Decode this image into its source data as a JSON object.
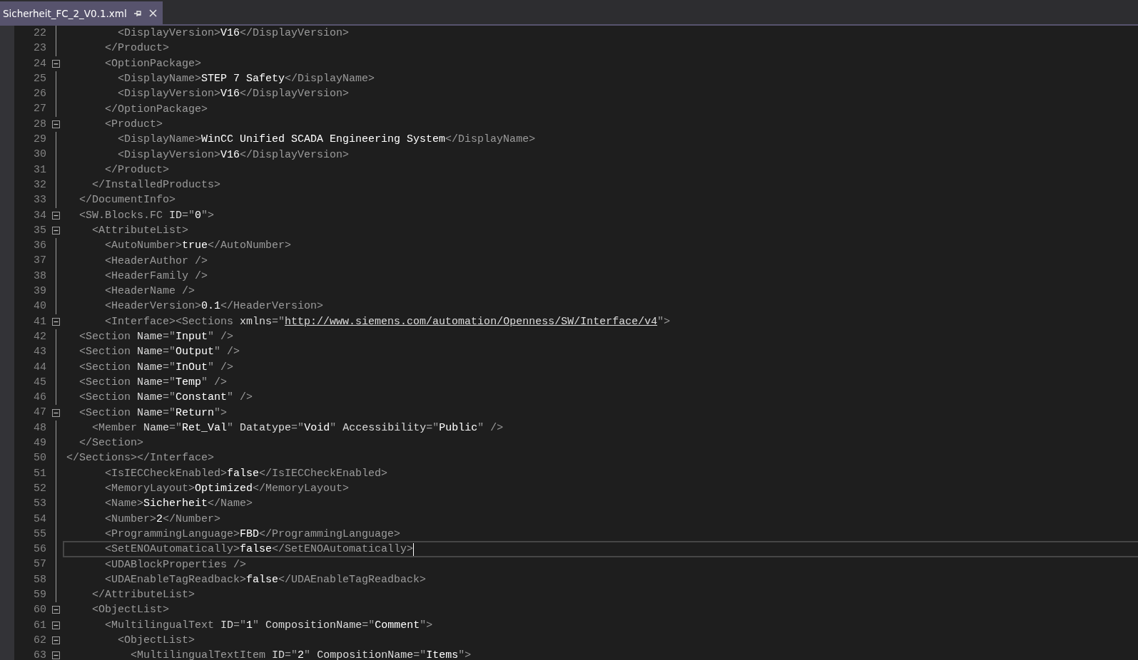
{
  "tab": {
    "title": "Sicherheit_FC_2_V0.1.xml"
  },
  "lines": [
    {
      "number": "22",
      "code": "        <DisplayVersion>V16</DisplayVersion>",
      "fold": false,
      "current": false
    },
    {
      "number": "23",
      "code": "      </Product>",
      "fold": false,
      "current": false
    },
    {
      "number": "24",
      "code": "      <OptionPackage>",
      "fold": true,
      "current": false
    },
    {
      "number": "25",
      "code": "        <DisplayName>STEP 7 Safety</DisplayName>",
      "fold": false,
      "current": false
    },
    {
      "number": "26",
      "code": "        <DisplayVersion>V16</DisplayVersion>",
      "fold": false,
      "current": false
    },
    {
      "number": "27",
      "code": "      </OptionPackage>",
      "fold": false,
      "current": false
    },
    {
      "number": "28",
      "code": "      <Product>",
      "fold": true,
      "current": false
    },
    {
      "number": "29",
      "code": "        <DisplayName>WinCC Unified SCADA Engineering System</DisplayName>",
      "fold": false,
      "current": false
    },
    {
      "number": "30",
      "code": "        <DisplayVersion>V16</DisplayVersion>",
      "fold": false,
      "current": false
    },
    {
      "number": "31",
      "code": "      </Product>",
      "fold": false,
      "current": false
    },
    {
      "number": "32",
      "code": "    </InstalledProducts>",
      "fold": false,
      "current": false
    },
    {
      "number": "33",
      "code": "  </DocumentInfo>",
      "fold": false,
      "current": false
    },
    {
      "number": "34",
      "code": "  <SW.Blocks.FC ID=\"0\">",
      "fold": true,
      "current": false
    },
    {
      "number": "35",
      "code": "    <AttributeList>",
      "fold": true,
      "current": false
    },
    {
      "number": "36",
      "code": "      <AutoNumber>true</AutoNumber>",
      "fold": false,
      "current": false
    },
    {
      "number": "37",
      "code": "      <HeaderAuthor />",
      "fold": false,
      "current": false
    },
    {
      "number": "38",
      "code": "      <HeaderFamily />",
      "fold": false,
      "current": false
    },
    {
      "number": "39",
      "code": "      <HeaderName />",
      "fold": false,
      "current": false
    },
    {
      "number": "40",
      "code": "      <HeaderVersion>0.1</HeaderVersion>",
      "fold": false,
      "current": false
    },
    {
      "number": "41",
      "code": "      <Interface><Sections xmlns=\"",
      "link": "http://www.siemens.com/automation/Openness/SW/Interface/v4",
      "after": "\">",
      "fold": true,
      "current": false
    },
    {
      "number": "42",
      "code": "  <Section Name=\"Input\" />",
      "fold": false,
      "current": false
    },
    {
      "number": "43",
      "code": "  <Section Name=\"Output\" />",
      "fold": false,
      "current": false
    },
    {
      "number": "44",
      "code": "  <Section Name=\"InOut\" />",
      "fold": false,
      "current": false
    },
    {
      "number": "45",
      "code": "  <Section Name=\"Temp\" />",
      "fold": false,
      "current": false
    },
    {
      "number": "46",
      "code": "  <Section Name=\"Constant\" />",
      "fold": false,
      "current": false
    },
    {
      "number": "47",
      "code": "  <Section Name=\"Return\">",
      "fold": true,
      "current": false
    },
    {
      "number": "48",
      "code": "    <Member Name=\"Ret_Val\" Datatype=\"Void\" Accessibility=\"Public\" />",
      "fold": false,
      "current": false
    },
    {
      "number": "49",
      "code": "  </Section>",
      "fold": false,
      "current": false
    },
    {
      "number": "50",
      "code": "</Sections></Interface>",
      "fold": false,
      "current": false
    },
    {
      "number": "51",
      "code": "      <IsIECCheckEnabled>false</IsIECCheckEnabled>",
      "fold": false,
      "current": false
    },
    {
      "number": "52",
      "code": "      <MemoryLayout>Optimized</MemoryLayout>",
      "fold": false,
      "current": false
    },
    {
      "number": "53",
      "code": "      <Name>Sicherheit</Name>",
      "fold": false,
      "current": false
    },
    {
      "number": "54",
      "code": "      <Number>2</Number>",
      "fold": false,
      "current": false
    },
    {
      "number": "55",
      "code": "      <ProgrammingLanguage>FBD</ProgrammingLanguage>",
      "fold": false,
      "current": false
    },
    {
      "number": "56",
      "code": "      <SetENOAutomatically>false</SetENOAutomatically>",
      "fold": false,
      "current": true
    },
    {
      "number": "57",
      "code": "      <UDABlockProperties />",
      "fold": false,
      "current": false
    },
    {
      "number": "58",
      "code": "      <UDAEnableTagReadback>false</UDAEnableTagReadback>",
      "fold": false,
      "current": false
    },
    {
      "number": "59",
      "code": "    </AttributeList>",
      "fold": false,
      "current": false
    },
    {
      "number": "60",
      "code": "    <ObjectList>",
      "fold": true,
      "current": false
    },
    {
      "number": "61",
      "code": "      <MultilingualText ID=\"1\" CompositionName=\"Comment\">",
      "fold": true,
      "current": false
    },
    {
      "number": "62",
      "code": "        <ObjectList>",
      "fold": true,
      "current": false
    },
    {
      "number": "63",
      "code": "          <MultilingualTextItem ID=\"2\" CompositionName=\"Items\">",
      "fold": true,
      "current": false
    }
  ]
}
